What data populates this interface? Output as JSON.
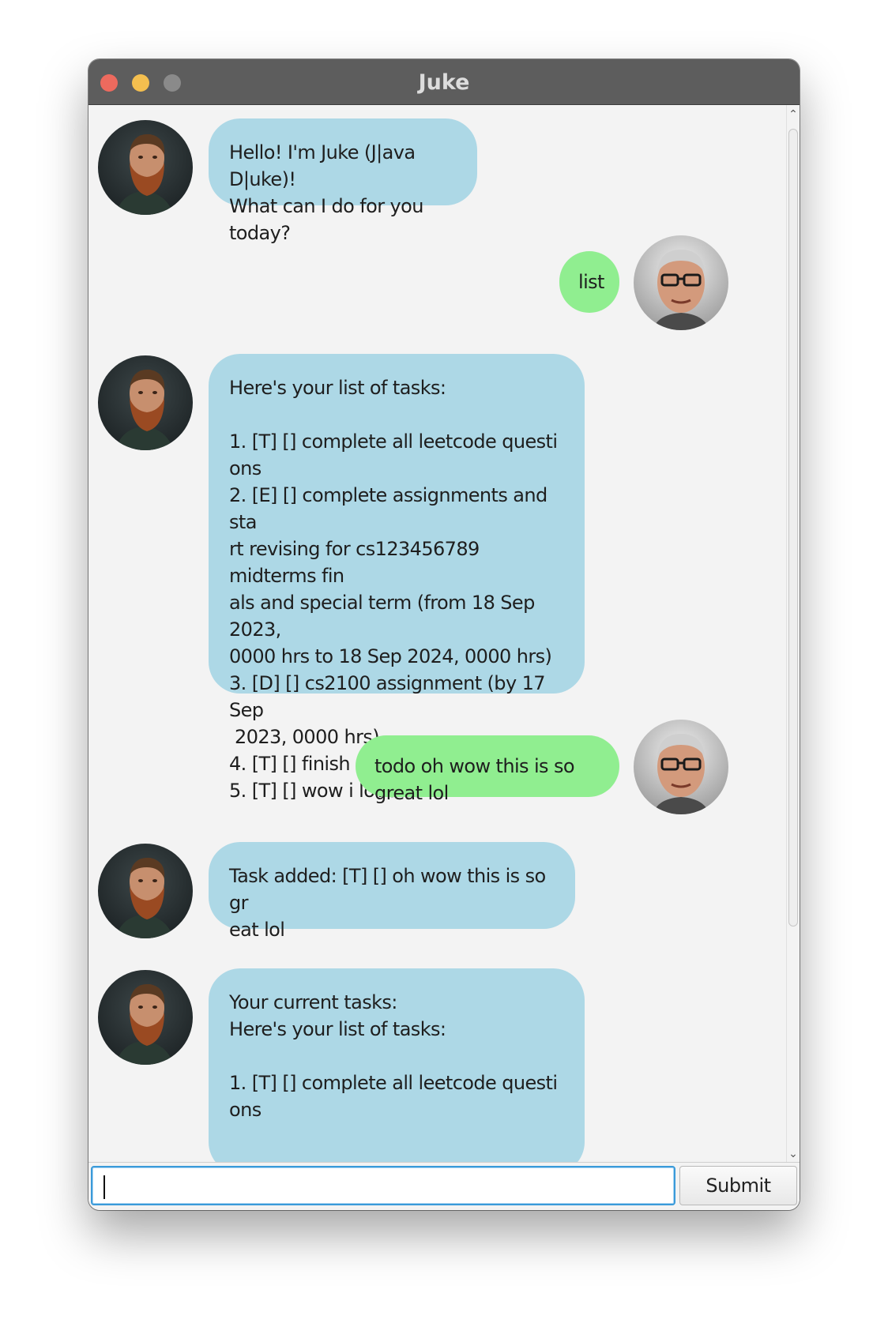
{
  "window": {
    "title": "Juke",
    "traffic_lights": {
      "close_color": "#ed6a5e",
      "minimize_color": "#f4bf4f",
      "zoom_color": "#8a8a8a"
    }
  },
  "colors": {
    "bot_bubble": "#add8e6",
    "user_bubble": "#90ee90",
    "background": "#f3f3f3",
    "focus_border": "#3a9ad9"
  },
  "avatars": {
    "bot": "bearded-man-avatar",
    "user": "man-with-glasses-avatar"
  },
  "messages": [
    {
      "sender": "bot",
      "text": "Hello! I'm Juke (J|ava D|uke)!\nWhat can I do for you today?"
    },
    {
      "sender": "user",
      "text": "list"
    },
    {
      "sender": "bot",
      "text": "Here's your list of tasks:\n\n1. [T] [] complete all leetcode questi\nons\n2. [E] [] complete assignments and sta\nrt revising for cs123456789 midterms fin\nals and special term (from 18 Sep 2023,\n0000 hrs to 18 Sep 2024, 0000 hrs)\n3. [D] [] cs2100 assignment (by 17 Sep\n 2023, 0000 hrs)\n4. [T] [] finish cs2103t assignment\n5. [T] [] wow i love cs"
    },
    {
      "sender": "user",
      "text": "todo oh wow this is so great lol"
    },
    {
      "sender": "bot",
      "text": "Task added: [T] [] oh wow this is so gr\neat lol"
    },
    {
      "sender": "bot",
      "text": "Your current tasks:\nHere's your list of tasks:\n\n1. [T] [] complete all leetcode questi\nons"
    }
  ],
  "input": {
    "value": "",
    "placeholder": ""
  },
  "submit_label": "Submit"
}
